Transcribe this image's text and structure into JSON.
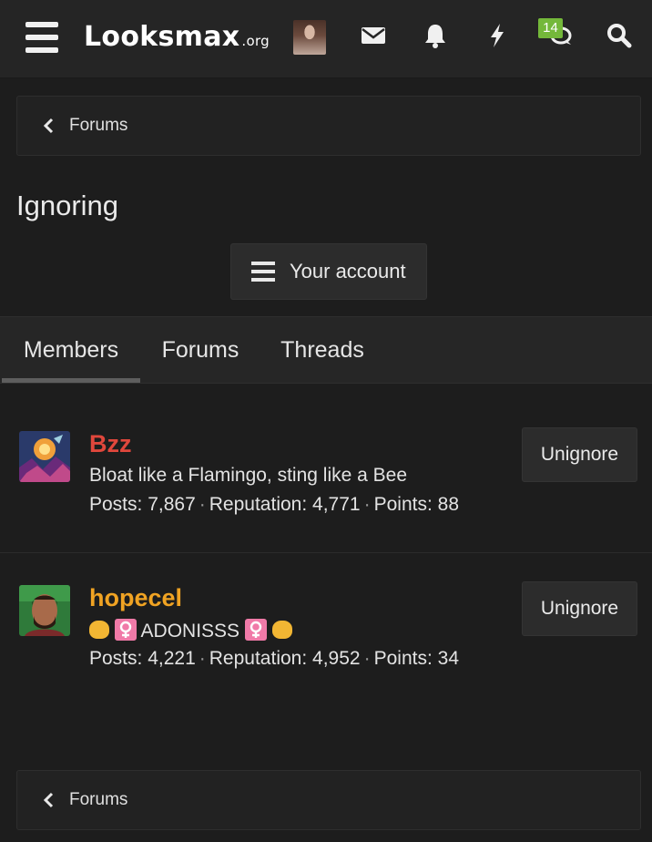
{
  "header": {
    "logo_main": "Looksmax",
    "logo_tld": ".org",
    "notification_badge": "14",
    "icons": [
      "menu-icon",
      "user-avatar",
      "mail-icon",
      "bell-icon",
      "bolt-icon",
      "chat-icon",
      "search-icon"
    ]
  },
  "breadcrumb": {
    "label": "Forums"
  },
  "page": {
    "title": "Ignoring",
    "account_button": "Your account"
  },
  "tabs": [
    {
      "label": "Members",
      "active": true
    },
    {
      "label": "Forums",
      "active": false
    },
    {
      "label": "Threads",
      "active": false
    }
  ],
  "members": [
    {
      "name": "Bzz",
      "name_color": "#e0473c",
      "tagline": "Bloat like a Flamingo, sting like a Bee",
      "posts_label": "Posts:",
      "posts": "7,867",
      "reputation_label": "Reputation:",
      "reputation": "4,771",
      "points_label": "Points:",
      "points": "88",
      "action": "Unignore"
    },
    {
      "name": "hopecel",
      "name_color": "#f0a323",
      "tagline": "ADONISSS",
      "tagline_emojis": [
        "fist",
        "female-sign",
        "female-sign",
        "fist"
      ],
      "posts_label": "Posts:",
      "posts": "4,221",
      "reputation_label": "Reputation:",
      "reputation": "4,952",
      "points_label": "Points:",
      "points": "34",
      "action": "Unignore"
    }
  ],
  "footer_breadcrumb": {
    "label": "Forums"
  },
  "colors": {
    "background": "#1d1d1d",
    "header": "#252525",
    "badge": "#74b83a"
  }
}
